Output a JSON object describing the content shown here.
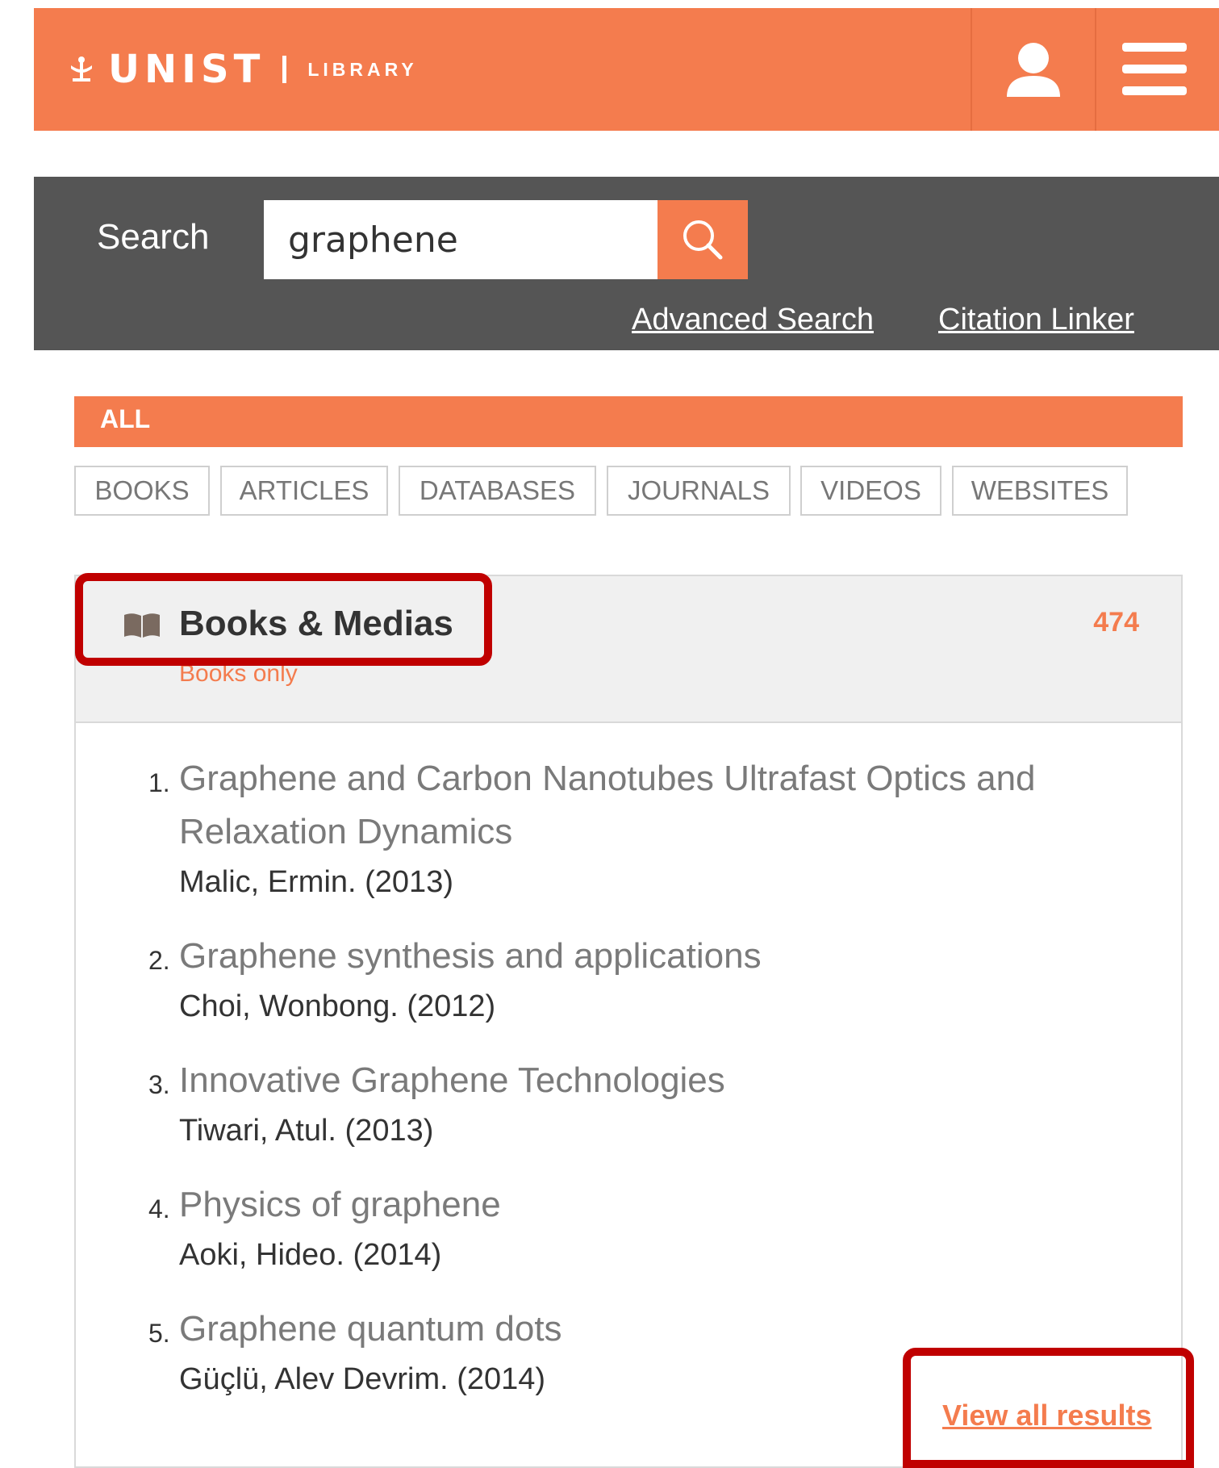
{
  "header": {
    "logo_word": "UNIST",
    "logo_sub": "LIBRARY"
  },
  "search": {
    "label": "Search",
    "query": "graphene",
    "advanced_link": "Advanced Search",
    "citation_link": "Citation Linker"
  },
  "tabs": {
    "active": "ALL",
    "categories": [
      "BOOKS",
      "ARTICLES",
      "DATABASES",
      "JOURNALS",
      "VIDEOS",
      "WEBSITES"
    ]
  },
  "results_card": {
    "title": "Books & Medias",
    "subtitle": "Books only",
    "count": "474",
    "items": [
      {
        "num": "1.",
        "title": "Graphene and Carbon Nanotubes Ultrafast Optics and Relaxation Dynamics",
        "author": "Malic, Ermin. (2013)"
      },
      {
        "num": "2.",
        "title": "Graphene synthesis and applications",
        "author": "Choi, Wonbong. (2012)"
      },
      {
        "num": "3.",
        "title": "Innovative Graphene Technologies",
        "author": "Tiwari, Atul. (2013)"
      },
      {
        "num": "4.",
        "title": "Physics of graphene",
        "author": "Aoki, Hideo. (2014)"
      },
      {
        "num": "5.",
        "title": "Graphene quantum dots",
        "author": "Güçlü, Alev Devrim. (2014)"
      }
    ],
    "view_all": "View all results"
  },
  "colors": {
    "brand_orange": "#F47C4E",
    "panel_gray": "#555555",
    "highlight_red": "#C00000"
  }
}
